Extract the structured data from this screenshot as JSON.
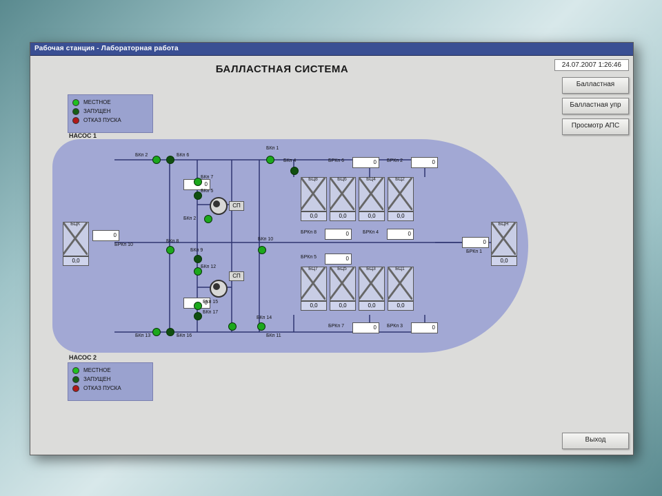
{
  "window_title": "Рабочая станция - Лабораторная работа",
  "timestamp": "24.07.2007 1:26:46",
  "nav": {
    "b1": "Балластная",
    "b2": "Балластная упр",
    "b3": "Просмотр АПС",
    "exit": "Выход"
  },
  "main_title": "БАЛЛАСТНАЯ СИСТЕМА",
  "legend": {
    "l1": "МЕСТНОЕ",
    "l2": "ЗАПУЩЕН",
    "l3": "ОТКАЗ ПУСКА"
  },
  "pump_labels": {
    "p1": "НАСОС 1",
    "p2": "НАСОС 2"
  },
  "sp": "СП",
  "valves": {
    "bkn2": "БКп 2",
    "bkn6": "БКп 6",
    "bkn1": "БКп 1",
    "bkn4": "БКп 4",
    "brkn6": "БРКп 6",
    "brkn2": "БРКп 2",
    "bkn7": "БКп 7",
    "bkn5": "БКп 5",
    "brkn8": "БРКп 8",
    "brkn4": "БРКп 4",
    "bkn2b": "БКп 2",
    "brkn10": "БРКп 10",
    "bkn8": "БКп 8",
    "bkn10": "БКп 10",
    "bkn9": "БКп 9",
    "brkn5": "БРКп 5",
    "bkn12": "БКп 12",
    "brkn1": "БРКп 1",
    "bkn15": "БКп 15",
    "bkn17": "БКп 17",
    "bkn13": "БКп 13",
    "bkn16": "БКп 16",
    "bkn14": "БКп 14",
    "bkn11": "БКп 11",
    "brkn7": "БРКп 7",
    "brkn3": "БРКп 3"
  },
  "tanks": {
    "left": {
      "name": "БЦК",
      "val": "0,0"
    },
    "right": {
      "name": "БЦН",
      "val": "0,0"
    },
    "top": [
      {
        "name": "БЦ8",
        "val": "0,0"
      },
      {
        "name": "БЦ6",
        "val": "0,0"
      },
      {
        "name": "БЦ4",
        "val": "0,0"
      },
      {
        "name": "БЦ2",
        "val": "0,0"
      }
    ],
    "bot": [
      {
        "name": "БЦ7",
        "val": "0,0"
      },
      {
        "name": "БЦ5",
        "val": "0,0"
      },
      {
        "name": "БЦ3",
        "val": "0,0"
      },
      {
        "name": "БЦ1",
        "val": "0,0"
      }
    ]
  },
  "fields": {
    "f_top1": "0",
    "f_pump1": "0",
    "f_brkn6": "0",
    "f_brkn2": "0",
    "f_left": "0",
    "f_brkn8": "0",
    "f_brkn4": "0",
    "f_right": "0",
    "f_pump2": "0",
    "f_brkn5": "0",
    "f_brkn7": "0",
    "f_brkn3": "0"
  }
}
